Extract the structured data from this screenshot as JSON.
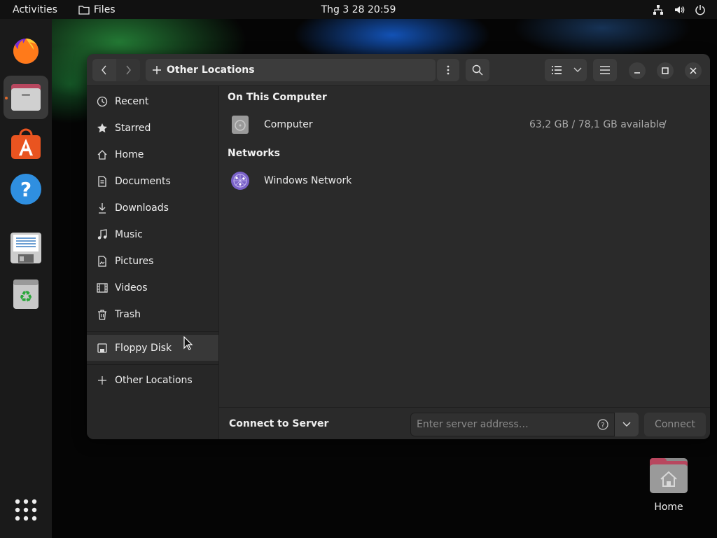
{
  "topbar": {
    "activities": "Activities",
    "app_name": "Files",
    "clock": "Thg 3 28  20:59"
  },
  "dock": {
    "apps": [
      "firefox-icon",
      "files-icon",
      "app-center-icon",
      "help-icon",
      "text-editor-icon",
      "trash-icon",
      "show-apps-icon"
    ]
  },
  "window": {
    "path": "Other Locations",
    "sidebar": {
      "items": [
        {
          "label": "Recent",
          "icon": "clock-icon"
        },
        {
          "label": "Starred",
          "icon": "star-icon"
        },
        {
          "label": "Home",
          "icon": "home-icon"
        },
        {
          "label": "Documents",
          "icon": "document-icon"
        },
        {
          "label": "Downloads",
          "icon": "download-icon"
        },
        {
          "label": "Music",
          "icon": "music-icon"
        },
        {
          "label": "Pictures",
          "icon": "picture-icon"
        },
        {
          "label": "Videos",
          "icon": "video-icon"
        },
        {
          "label": "Trash",
          "icon": "trash-icon"
        }
      ],
      "devices": [
        {
          "label": "Floppy Disk",
          "icon": "floppy-icon"
        }
      ],
      "other_locations": "Other Locations"
    },
    "content": {
      "on_this_computer": "On This Computer",
      "computer": {
        "label": "Computer",
        "space": "63,2 GB / 78,1 GB available",
        "mount": "/"
      },
      "networks": "Networks",
      "windows_network": "Windows Network"
    },
    "connect": {
      "label": "Connect to Server",
      "placeholder": "Enter server address…",
      "button": "Connect"
    }
  },
  "desktop": {
    "home_label": "Home"
  },
  "colors": {
    "accent": "#e95420",
    "window_bg": "#2a2a2a",
    "headerbar_bg": "#303030"
  }
}
